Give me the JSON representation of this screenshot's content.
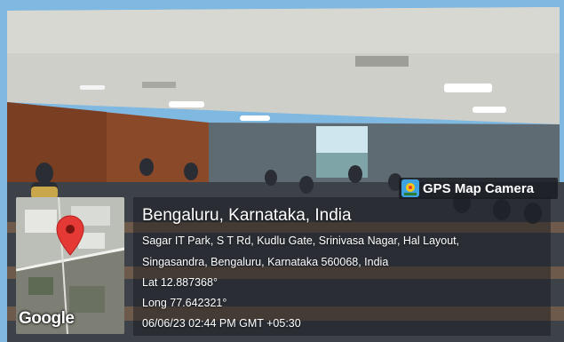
{
  "stamp": {
    "app_name": "GPS Map Camera",
    "city_line": "Bengaluru, Karnataka, India",
    "address_line_1": "Sagar IT Park, S T Rd, Kudlu Gate, Srinivasa Nagar, Hal Layout,",
    "address_line_2": "Singasandra, Bengaluru, Karnataka 560068, India",
    "latitude": "Lat 12.887368°",
    "longitude": "Long 77.642321°",
    "datetime": "06/06/23 02:44 PM GMT +05:30",
    "map_logo": "Google"
  },
  "icons": {
    "map_pin": "map-pin-icon",
    "app_logo": "gps-map-camera-icon"
  },
  "colors": {
    "pin_red": "#e53935",
    "badge_bg": "#1c1f26",
    "ceiling": "#c9c9c4",
    "wood_wall": "#8a4a2a"
  }
}
